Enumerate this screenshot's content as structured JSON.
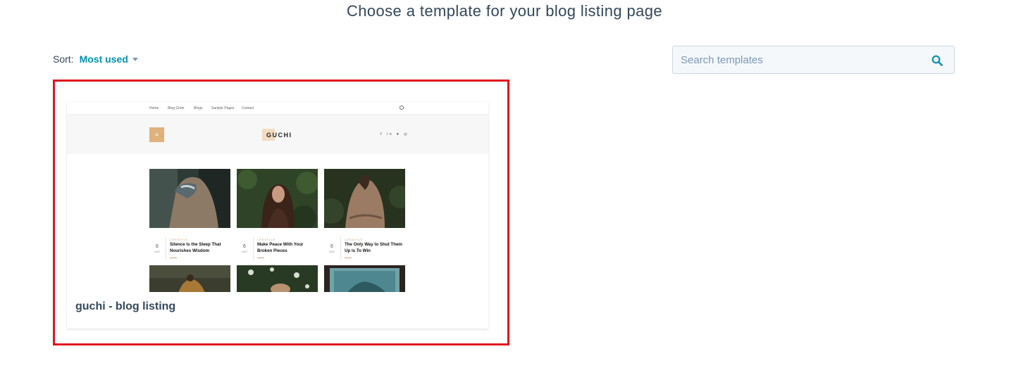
{
  "page": {
    "title": "Choose a template for your blog listing page"
  },
  "sort": {
    "label": "Sort:",
    "value": "Most used",
    "icon": "caret-down-icon"
  },
  "search": {
    "placeholder": "Search templates",
    "icon": "search-icon",
    "value": ""
  },
  "colors": {
    "accent": "#0091ae",
    "highlight_border": "#e0151f",
    "heading_text": "#33475b",
    "preview_accent": "#deb27c"
  },
  "templates": [
    {
      "name": "guchi - blog listing",
      "preview": {
        "nav_items": [
          "Home",
          "Blog Grids",
          "Blogs",
          "Sample Pages",
          "Contact"
        ],
        "logo": "GUCHI",
        "posts": [
          {
            "category": "LIFESTYLE",
            "day": "6",
            "month": "MAR",
            "title": "Silence Is the Sleep That Nourishes Wisdom"
          },
          {
            "category": "LIFESTYLE",
            "day": "6",
            "month": "MAR",
            "title": "Make Peace With Your Broken Pieces"
          },
          {
            "category": "LIFESTYLE",
            "day": "6",
            "month": "MAR",
            "title": "The Only Way to Shut Them Up is To Win"
          }
        ]
      }
    }
  ]
}
